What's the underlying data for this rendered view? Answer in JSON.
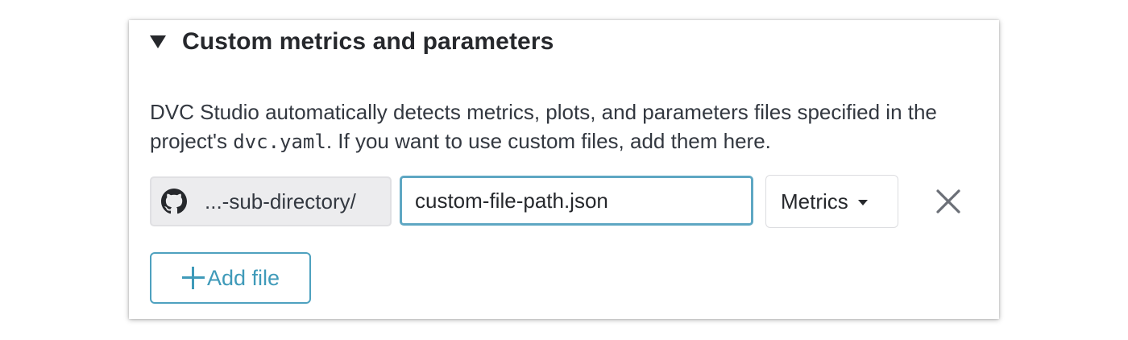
{
  "section": {
    "title": "Custom metrics and parameters",
    "expanded": true
  },
  "description": {
    "before_code": "DVC Studio automatically detects metrics, plots, and parameters files specified in the project's ",
    "code": "dvc.yaml",
    "after_code": ". If you want to use custom files, add them here."
  },
  "file_row": {
    "repo_icon": "github-icon",
    "prefix": "...-sub-directory/",
    "path_value": "custom-file-path.json",
    "file_type": "Metrics",
    "remove_icon": "close-icon"
  },
  "add_button": {
    "label": "Add file",
    "icon": "plus-icon"
  },
  "colors": {
    "accent": "#3f9ab9",
    "input_border": "#5ea7c3",
    "prefix_bg": "#ececee",
    "text": "#333840"
  }
}
